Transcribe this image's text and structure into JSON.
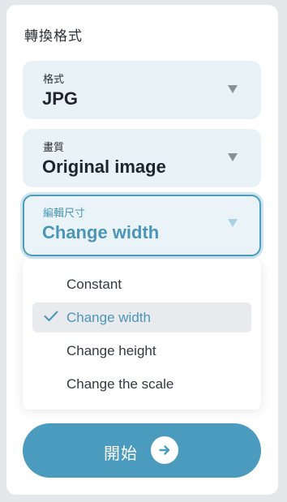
{
  "panel": {
    "title": "轉換格式"
  },
  "format": {
    "label": "格式",
    "value": "JPG",
    "icon": "chevron-down-icon"
  },
  "quality": {
    "label": "畫質",
    "value": "Original image",
    "icon": "chevron-down-icon"
  },
  "resize": {
    "label": "編輯尺寸",
    "value": "Change width",
    "icon": "chevron-down-icon",
    "expanded": true
  },
  "dropdown": {
    "options": [
      {
        "label": "Constant",
        "selected": false
      },
      {
        "label": "Change width",
        "selected": true
      },
      {
        "label": "Change height",
        "selected": false
      },
      {
        "label": "Change the scale",
        "selected": false
      }
    ],
    "selected_icon": "checkmark-icon"
  },
  "start_button": {
    "label": "開始",
    "icon": "arrow-right-icon"
  },
  "colors": {
    "accent": "#4a9bbd",
    "field_bg": "#e9f3f7",
    "text_dark": "#1f2433",
    "page_bg": "#e6e7ea"
  }
}
